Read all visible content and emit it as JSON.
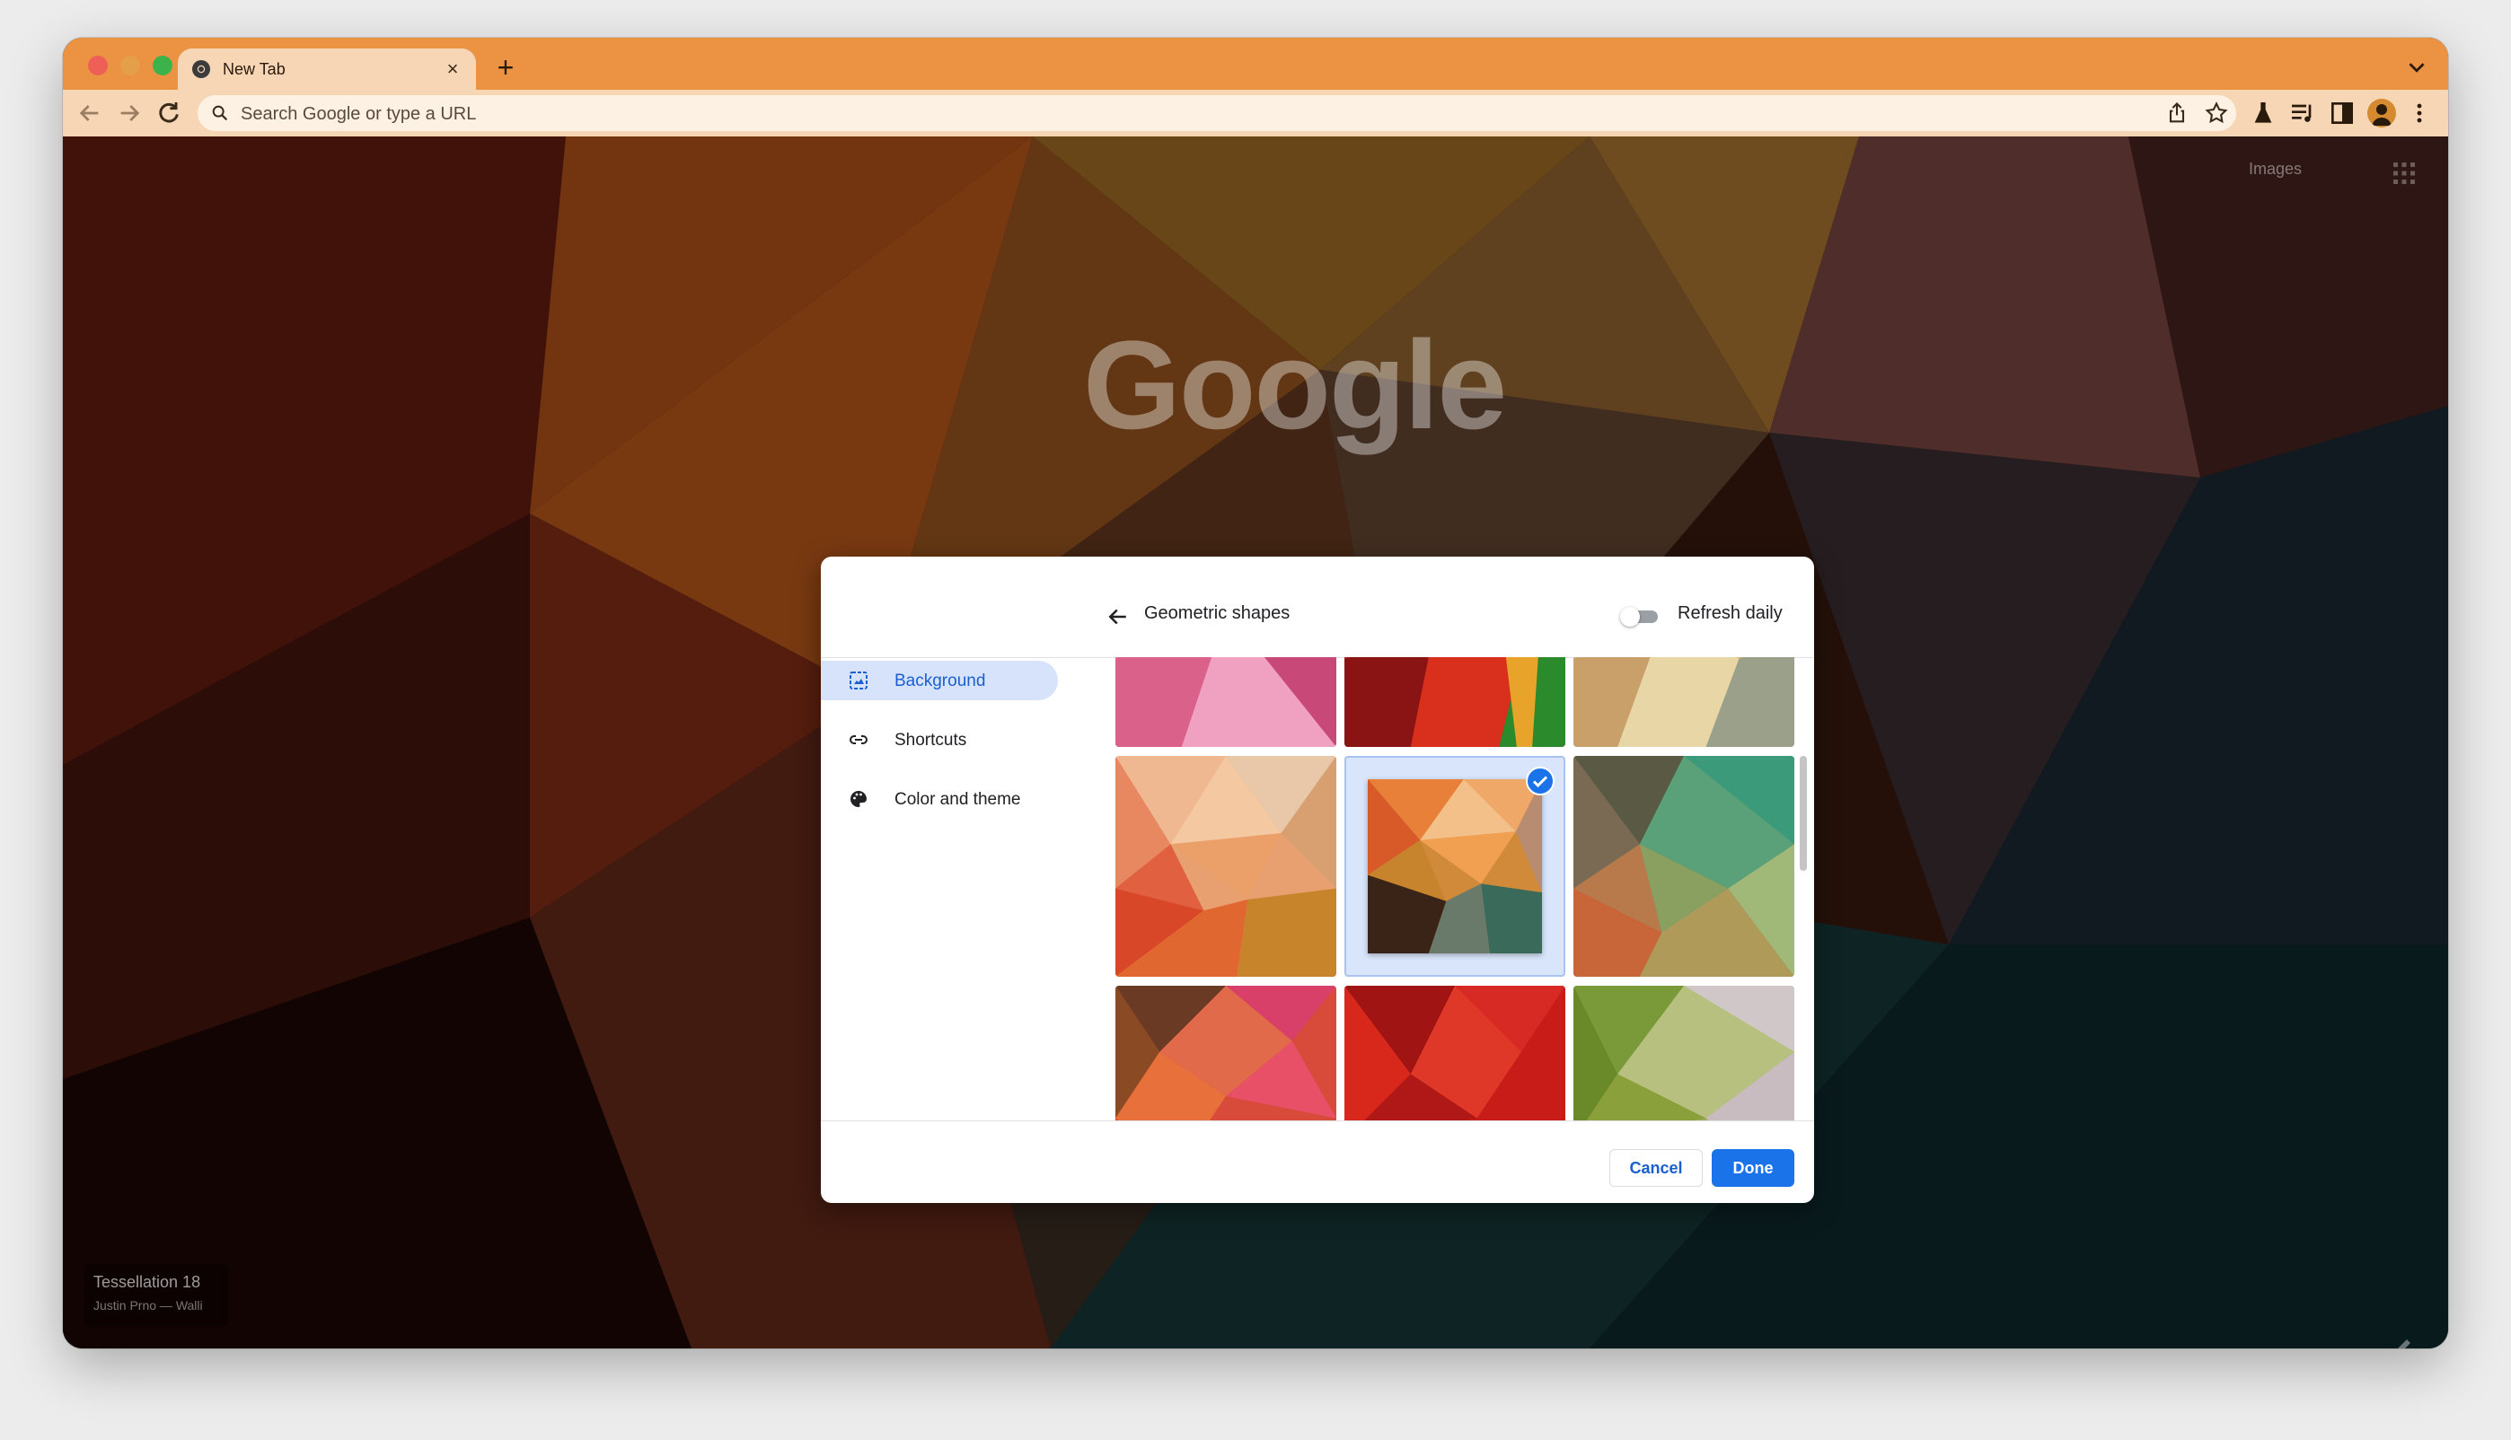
{
  "browser": {
    "tab": {
      "title": "New Tab"
    },
    "omnibox": {
      "placeholder": "Search Google or type a URL"
    }
  },
  "ntp": {
    "images_link": "Images",
    "logo_text": "Google",
    "attribution": {
      "title": "Tessellation 18",
      "author": "Justin Prno — Walli"
    }
  },
  "dialog": {
    "title": "Geometric shapes",
    "refresh_daily": {
      "label": "Refresh daily",
      "enabled": false
    },
    "menu": [
      {
        "label": "Background",
        "icon": "background-icon",
        "active": true
      },
      {
        "label": "Shortcuts",
        "icon": "link-icon",
        "active": false
      },
      {
        "label": "Color and theme",
        "icon": "palette-icon",
        "active": false
      }
    ],
    "selected_tile_index": 4,
    "buttons": {
      "cancel": "Cancel",
      "done": "Done"
    }
  },
  "colors": {
    "tab_strip": "#ec9343",
    "toolbar": "#f7d6b5",
    "accent_blue": "#1a73e8",
    "menu_active_bg": "#d6e3fb"
  }
}
